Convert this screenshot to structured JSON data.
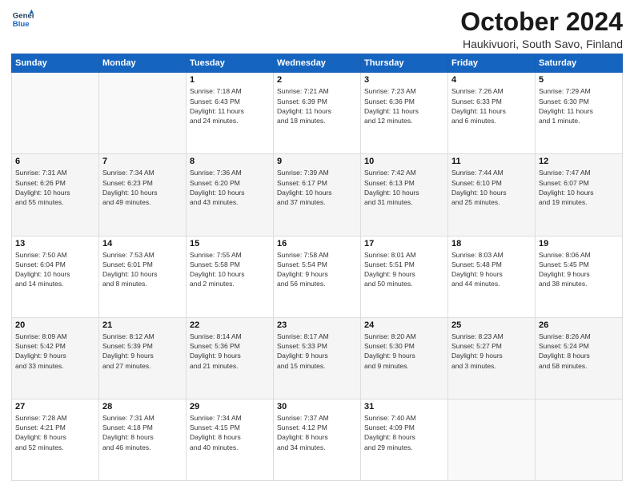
{
  "header": {
    "logo_line1": "General",
    "logo_line2": "Blue",
    "month_title": "October 2024",
    "location": "Haukivuori, South Savo, Finland"
  },
  "days_of_week": [
    "Sunday",
    "Monday",
    "Tuesday",
    "Wednesday",
    "Thursday",
    "Friday",
    "Saturday"
  ],
  "weeks": [
    [
      {
        "day": "",
        "detail": ""
      },
      {
        "day": "",
        "detail": ""
      },
      {
        "day": "1",
        "detail": "Sunrise: 7:18 AM\nSunset: 6:43 PM\nDaylight: 11 hours\nand 24 minutes."
      },
      {
        "day": "2",
        "detail": "Sunrise: 7:21 AM\nSunset: 6:39 PM\nDaylight: 11 hours\nand 18 minutes."
      },
      {
        "day": "3",
        "detail": "Sunrise: 7:23 AM\nSunset: 6:36 PM\nDaylight: 11 hours\nand 12 minutes."
      },
      {
        "day": "4",
        "detail": "Sunrise: 7:26 AM\nSunset: 6:33 PM\nDaylight: 11 hours\nand 6 minutes."
      },
      {
        "day": "5",
        "detail": "Sunrise: 7:29 AM\nSunset: 6:30 PM\nDaylight: 11 hours\nand 1 minute."
      }
    ],
    [
      {
        "day": "6",
        "detail": "Sunrise: 7:31 AM\nSunset: 6:26 PM\nDaylight: 10 hours\nand 55 minutes."
      },
      {
        "day": "7",
        "detail": "Sunrise: 7:34 AM\nSunset: 6:23 PM\nDaylight: 10 hours\nand 49 minutes."
      },
      {
        "day": "8",
        "detail": "Sunrise: 7:36 AM\nSunset: 6:20 PM\nDaylight: 10 hours\nand 43 minutes."
      },
      {
        "day": "9",
        "detail": "Sunrise: 7:39 AM\nSunset: 6:17 PM\nDaylight: 10 hours\nand 37 minutes."
      },
      {
        "day": "10",
        "detail": "Sunrise: 7:42 AM\nSunset: 6:13 PM\nDaylight: 10 hours\nand 31 minutes."
      },
      {
        "day": "11",
        "detail": "Sunrise: 7:44 AM\nSunset: 6:10 PM\nDaylight: 10 hours\nand 25 minutes."
      },
      {
        "day": "12",
        "detail": "Sunrise: 7:47 AM\nSunset: 6:07 PM\nDaylight: 10 hours\nand 19 minutes."
      }
    ],
    [
      {
        "day": "13",
        "detail": "Sunrise: 7:50 AM\nSunset: 6:04 PM\nDaylight: 10 hours\nand 14 minutes."
      },
      {
        "day": "14",
        "detail": "Sunrise: 7:53 AM\nSunset: 6:01 PM\nDaylight: 10 hours\nand 8 minutes."
      },
      {
        "day": "15",
        "detail": "Sunrise: 7:55 AM\nSunset: 5:58 PM\nDaylight: 10 hours\nand 2 minutes."
      },
      {
        "day": "16",
        "detail": "Sunrise: 7:58 AM\nSunset: 5:54 PM\nDaylight: 9 hours\nand 56 minutes."
      },
      {
        "day": "17",
        "detail": "Sunrise: 8:01 AM\nSunset: 5:51 PM\nDaylight: 9 hours\nand 50 minutes."
      },
      {
        "day": "18",
        "detail": "Sunrise: 8:03 AM\nSunset: 5:48 PM\nDaylight: 9 hours\nand 44 minutes."
      },
      {
        "day": "19",
        "detail": "Sunrise: 8:06 AM\nSunset: 5:45 PM\nDaylight: 9 hours\nand 38 minutes."
      }
    ],
    [
      {
        "day": "20",
        "detail": "Sunrise: 8:09 AM\nSunset: 5:42 PM\nDaylight: 9 hours\nand 33 minutes."
      },
      {
        "day": "21",
        "detail": "Sunrise: 8:12 AM\nSunset: 5:39 PM\nDaylight: 9 hours\nand 27 minutes."
      },
      {
        "day": "22",
        "detail": "Sunrise: 8:14 AM\nSunset: 5:36 PM\nDaylight: 9 hours\nand 21 minutes."
      },
      {
        "day": "23",
        "detail": "Sunrise: 8:17 AM\nSunset: 5:33 PM\nDaylight: 9 hours\nand 15 minutes."
      },
      {
        "day": "24",
        "detail": "Sunrise: 8:20 AM\nSunset: 5:30 PM\nDaylight: 9 hours\nand 9 minutes."
      },
      {
        "day": "25",
        "detail": "Sunrise: 8:23 AM\nSunset: 5:27 PM\nDaylight: 9 hours\nand 3 minutes."
      },
      {
        "day": "26",
        "detail": "Sunrise: 8:26 AM\nSunset: 5:24 PM\nDaylight: 8 hours\nand 58 minutes."
      }
    ],
    [
      {
        "day": "27",
        "detail": "Sunrise: 7:28 AM\nSunset: 4:21 PM\nDaylight: 8 hours\nand 52 minutes."
      },
      {
        "day": "28",
        "detail": "Sunrise: 7:31 AM\nSunset: 4:18 PM\nDaylight: 8 hours\nand 46 minutes."
      },
      {
        "day": "29",
        "detail": "Sunrise: 7:34 AM\nSunset: 4:15 PM\nDaylight: 8 hours\nand 40 minutes."
      },
      {
        "day": "30",
        "detail": "Sunrise: 7:37 AM\nSunset: 4:12 PM\nDaylight: 8 hours\nand 34 minutes."
      },
      {
        "day": "31",
        "detail": "Sunrise: 7:40 AM\nSunset: 4:09 PM\nDaylight: 8 hours\nand 29 minutes."
      },
      {
        "day": "",
        "detail": ""
      },
      {
        "day": "",
        "detail": ""
      }
    ]
  ]
}
